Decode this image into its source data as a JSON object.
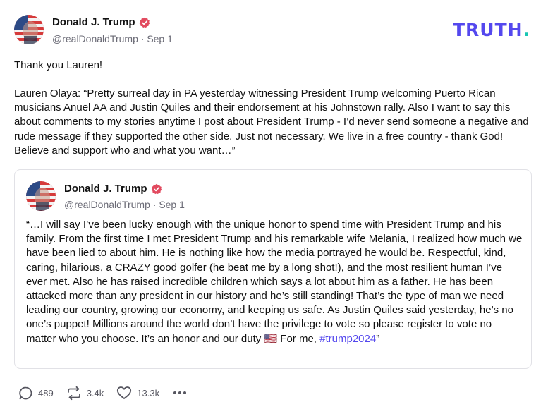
{
  "post": {
    "author": {
      "name": "Donald J. Trump",
      "handle": "@realDonaldTrump",
      "date": "Sep 1",
      "avatar_icon": "flag-portrait-avatar",
      "verified_icon": "verified-badge-icon"
    },
    "brand": {
      "logo_text": "TRUTH",
      "logo_dot": "."
    },
    "intro": "Thank you Lauren!",
    "body": "Lauren Olaya: “Pretty surreal day in PA yesterday witnessing President Trump welcoming Puerto Rican musicians Anuel AA and Justin Quiles and their endorsement at his Johnstown rally. Also I want to say this about comments to my stories anytime I post about President Trump - I’d never send someone a negative and rude message if they supported the other side. Just not necessary. We live in a free country - thank God! Believe and support who and what you want…”",
    "quoted": {
      "author": {
        "name": "Donald J. Trump",
        "handle": "@realDonaldTrump",
        "date": "Sep 1"
      },
      "text": "“…I will say I’ve been lucky enough with the unique honor to spend time with President Trump and his family. From the first time I met President Trump and his remarkable wife Melania, I realized how much we have been lied to about him. He is nothing like how the media portrayed he would be. Respectful, kind, caring, hilarious, a CRAZY good golfer (he beat me by a long shot!), and the most resilient human I’ve ever met. Also he has raised incredible children which says a lot about him as a father. He has been attacked more than any president in our history and he’s still standing! That’s the type of man we need leading our country, growing our economy, and keeping us safe. As Justin Quiles said yesterday, he’s no one’s puppet! Millions around the world don’t have the privilege to vote so please register to vote no matter who you choose. It’s an honor and our duty",
      "flag": "🇺🇸",
      "closing": " For me, ",
      "hashtag": "#trump2024",
      "end_quote": "”"
    },
    "actions": {
      "replies": "489",
      "retruths": "3.4k",
      "likes": "13.3k",
      "icons": [
        "reply-icon",
        "retruth-icon",
        "like-icon",
        "more-icon"
      ]
    },
    "colors": {
      "brand": "#5448ee",
      "accent_dot": "#19c6b3",
      "verified": "#e24a5f",
      "muted": "#6b6b76"
    }
  }
}
